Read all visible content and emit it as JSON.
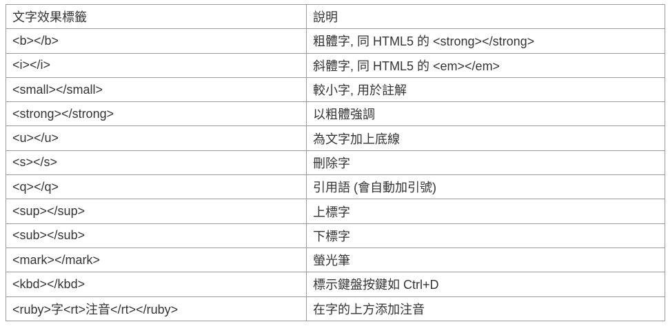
{
  "table": {
    "headers": [
      "文字效果標籤",
      "說明"
    ],
    "rows": [
      [
        "<b></b>",
        "粗體字, 同 HTML5 的 <strong></strong>"
      ],
      [
        "<i></i>",
        "斜體字, 同 HTML5 的 <em></em>"
      ],
      [
        "<small></small>",
        "較小字, 用於註解"
      ],
      [
        "<strong></strong>",
        "以粗體強調"
      ],
      [
        "<u></u>",
        "為文字加上底線"
      ],
      [
        "<s></s>",
        "刪除字"
      ],
      [
        "<q></q>",
        "引用語 (會自動加引號)"
      ],
      [
        "<sup></sup>",
        "上標字"
      ],
      [
        "<sub></sub>",
        "下標字"
      ],
      [
        "<mark></mark>",
        "螢光筆"
      ],
      [
        "<kbd></kbd>",
        "標示鍵盤按鍵如 Ctrl+D"
      ],
      [
        "<ruby>字<rt>注音</rt></ruby>",
        "在字的上方添加注音"
      ]
    ]
  }
}
